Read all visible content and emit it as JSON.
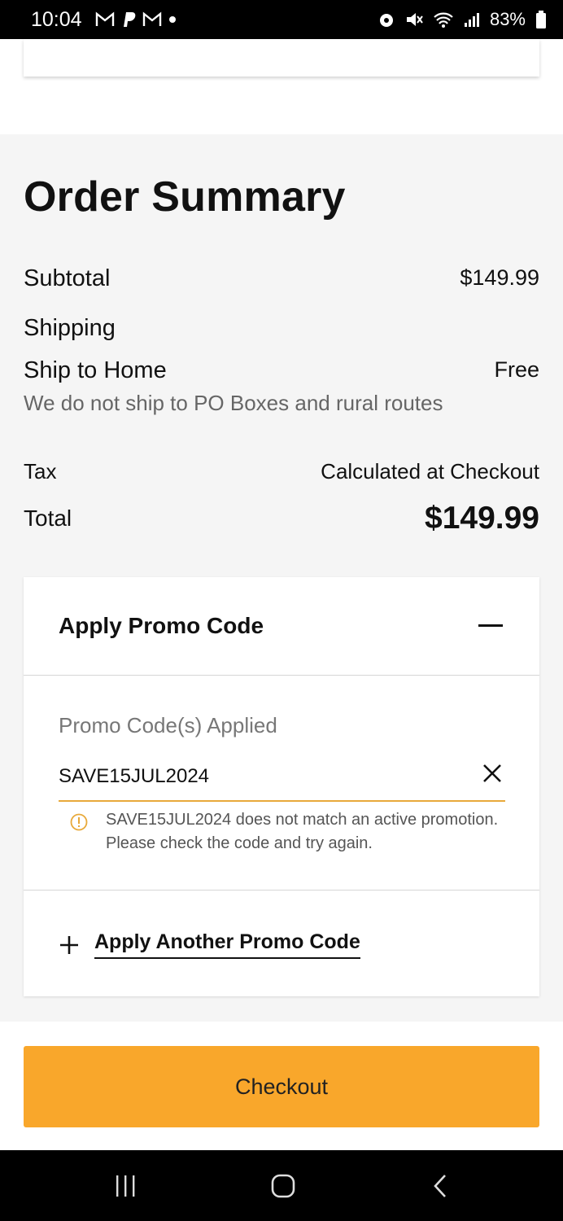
{
  "status_bar": {
    "time": "10:04",
    "battery": "83%"
  },
  "order_summary": {
    "title": "Order Summary",
    "subtotal_label": "Subtotal",
    "subtotal_value": "$149.99",
    "shipping_label": "Shipping",
    "ship_to_home_label": "Ship to Home",
    "ship_to_home_value": "Free",
    "shipping_note": "We do not ship to PO Boxes and rural routes",
    "tax_label": "Tax",
    "tax_value": "Calculated at Checkout",
    "total_label": "Total",
    "total_value": "$149.99"
  },
  "promo": {
    "header": "Apply Promo Code",
    "applied_label": "Promo Code(s) Applied",
    "code": "SAVE15JUL2024",
    "error_message": "SAVE15JUL2024 does not match an active promotion. Please check the code and try again.",
    "apply_another": "Apply Another Promo Code"
  },
  "checkout_label": "Checkout",
  "colors": {
    "accent": "#f9a72b",
    "input_underline": "#e8a93a"
  }
}
